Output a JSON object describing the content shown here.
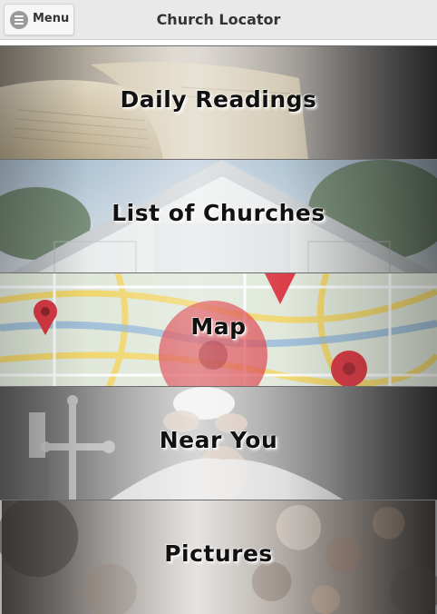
{
  "header": {
    "menu_label": "Menu",
    "title": "Church Locator"
  },
  "tiles": [
    {
      "label": "Daily Readings",
      "icon": "open-book-image"
    },
    {
      "label": "List of Churches",
      "icon": "church-building-image"
    },
    {
      "label": "Map",
      "icon": "map-pins-image"
    },
    {
      "label": "Near You",
      "icon": "priest-eucharist-image"
    },
    {
      "label": "Pictures",
      "icon": "blurred-congregation-image"
    }
  ],
  "colors": {
    "header_bg": "#e9e9e9",
    "label_text": "#111111",
    "map_pin": "#d9343f"
  }
}
